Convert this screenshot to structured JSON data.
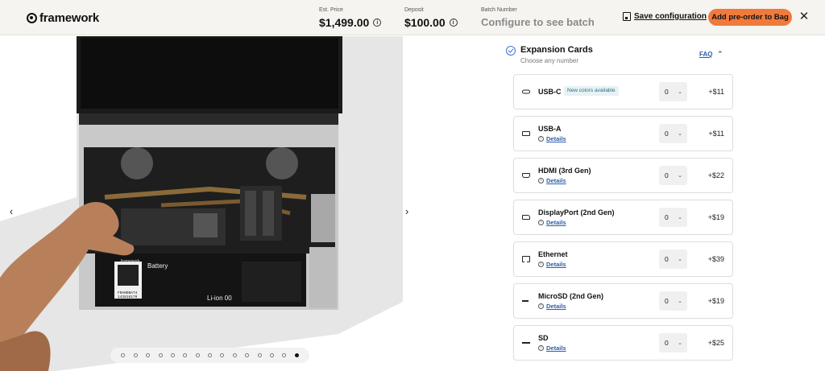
{
  "header": {
    "logo_text": "framework",
    "est_price_label": "Est. Price",
    "est_price": "$1,499.00",
    "deposit_label": "Deposit",
    "deposit": "$100.00",
    "batch_label": "Batch Number",
    "batch_value": "Configure to see batch",
    "save_label": "Save configuration",
    "add_label": "Add pre-order to Bag",
    "close_symbol": "✕",
    "info_symbol": "i"
  },
  "gallery": {
    "prev_symbol": "‹",
    "next_symbol": "›",
    "dot_count": 15,
    "active_dot": 14,
    "laptop_logo_text": "framework",
    "battery_label": "Battery",
    "battery_code": "FRANDBAT4",
    "battery_number": "143818170",
    "battery_type": "Li-ion 00"
  },
  "section": {
    "title": "Expansion Cards",
    "subtitle": "Choose any number",
    "faq_label": "FAQ",
    "collapse_symbol": "⌃"
  },
  "cards": [
    {
      "name": "USB-C",
      "icon": "usb-c-icon",
      "badge": "New colors available",
      "details": "",
      "qty": "0",
      "price": "+$11"
    },
    {
      "name": "USB-A",
      "icon": "usb-a-icon",
      "badge": "",
      "details": "Details",
      "qty": "0",
      "price": "+$11"
    },
    {
      "name": "HDMI (3rd Gen)",
      "icon": "hdmi-icon",
      "badge": "",
      "details": "Details",
      "qty": "0",
      "price": "+$22"
    },
    {
      "name": "DisplayPort (2nd Gen)",
      "icon": "displayport-icon",
      "badge": "",
      "details": "Details",
      "qty": "0",
      "price": "+$19"
    },
    {
      "name": "Ethernet",
      "icon": "ethernet-icon",
      "badge": "",
      "details": "Details",
      "qty": "0",
      "price": "+$39"
    },
    {
      "name": "MicroSD (2nd Gen)",
      "icon": "microsd-icon",
      "badge": "",
      "details": "Details",
      "qty": "0",
      "price": "+$19"
    },
    {
      "name": "SD",
      "icon": "sd-icon",
      "badge": "",
      "details": "Details",
      "qty": "0",
      "price": "+$25"
    }
  ],
  "qty_chevron": "⌄",
  "details_icon": "i"
}
